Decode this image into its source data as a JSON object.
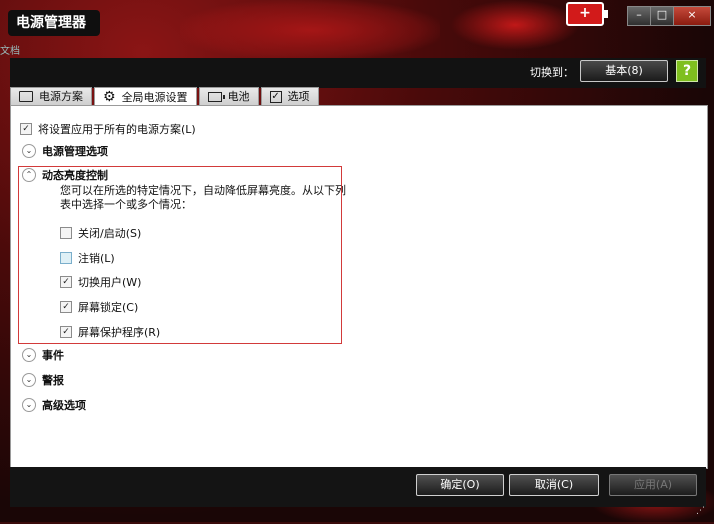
{
  "window": {
    "title": "电源管理器",
    "side_text": "文档",
    "battery_glyph": "+",
    "minimize": "–",
    "maximize": "□",
    "close": "×"
  },
  "header": {
    "switch_label": "切换到：",
    "basic_button": "基本(8)",
    "help": "?"
  },
  "tabs": [
    {
      "label": "电源方案",
      "icon": "window-icon"
    },
    {
      "label": "全局电源设置",
      "icon": "gear-icon",
      "active": true
    },
    {
      "label": "电池",
      "icon": "battery-icon"
    },
    {
      "label": "选项",
      "icon": "checkbox-icon"
    }
  ],
  "content": {
    "apply_all": {
      "label": "将设置应用于所有的电源方案(L)",
      "checked": true
    },
    "power_options": "电源管理选项",
    "dynamic": {
      "title": "动态亮度控制",
      "description": "您可以在所选的特定情况下，自动降低屏幕亮度。从以下列表中选择一个或多个情况：",
      "items": [
        {
          "label": "关闭/启动(S)",
          "checked": false
        },
        {
          "label": "注销(L)",
          "checked": false
        },
        {
          "label": "切换用户(W)",
          "checked": true
        },
        {
          "label": "屏幕锁定(C)",
          "checked": true
        },
        {
          "label": "屏幕保护程序(R)",
          "checked": true
        }
      ]
    },
    "events": "事件",
    "alerts": "警报",
    "advanced": "高级选项"
  },
  "footer": {
    "ok": "确定(O)",
    "cancel": "取消(C)",
    "apply": "应用(A)"
  },
  "check_mark": "✓",
  "chevron_down": "⌄",
  "chevron_up": "⌃"
}
